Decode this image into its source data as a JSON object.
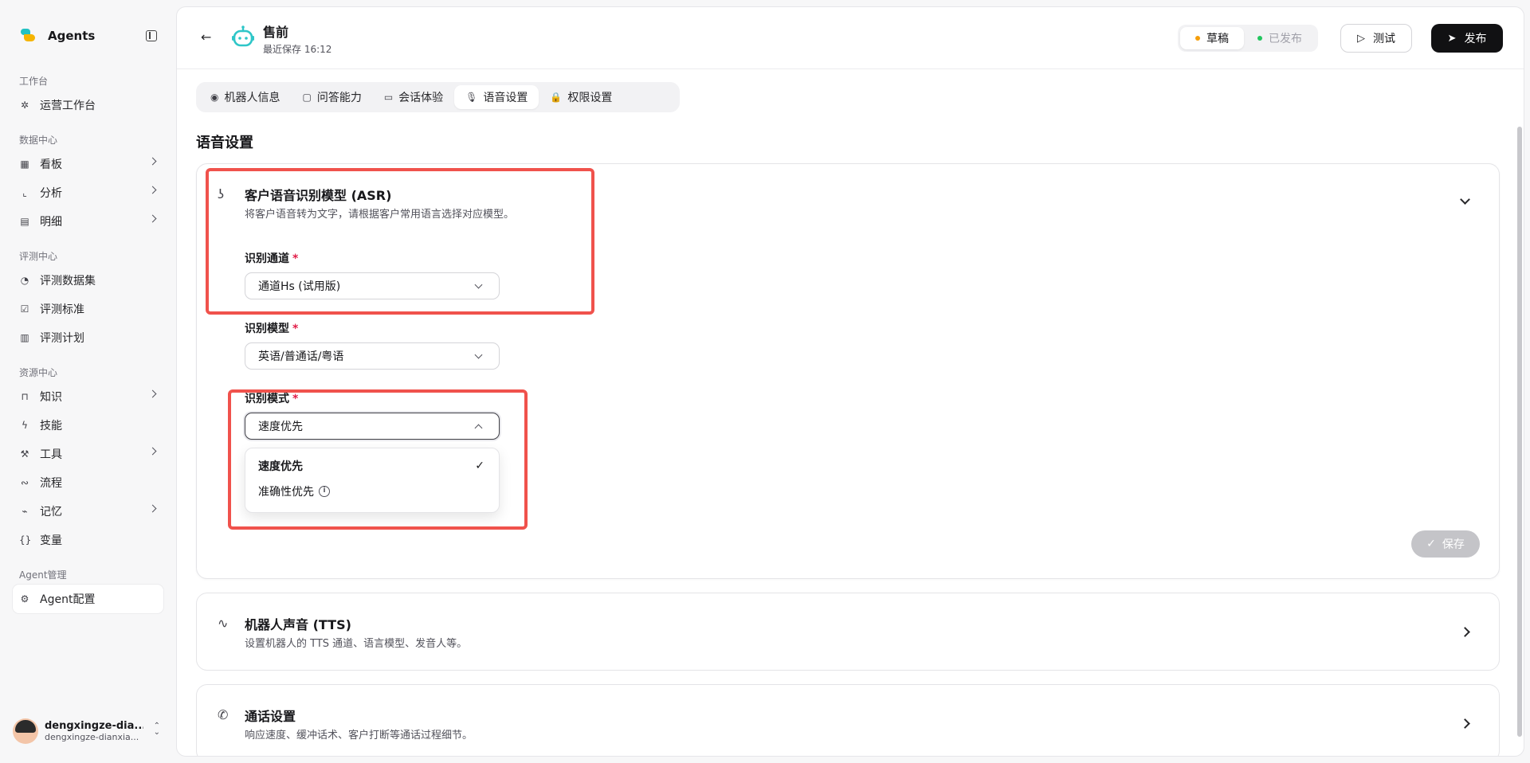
{
  "app": {
    "name": "Agents"
  },
  "sidebar": {
    "groups": [
      {
        "title": "工作台",
        "items": [
          {
            "label": "运营工作台",
            "icon": "sparkle-icon",
            "chevron": false
          }
        ]
      },
      {
        "title": "数据中心",
        "items": [
          {
            "label": "看板",
            "icon": "grid-icon",
            "chevron": true
          },
          {
            "label": "分析",
            "icon": "chart-icon",
            "chevron": true
          },
          {
            "label": "明细",
            "icon": "document-icon",
            "chevron": true
          }
        ]
      },
      {
        "title": "评测中心",
        "items": [
          {
            "label": "评测数据集",
            "icon": "pie-icon",
            "chevron": false
          },
          {
            "label": "评测标准",
            "icon": "check-square-icon",
            "chevron": false
          },
          {
            "label": "评测计划",
            "icon": "clipboard-icon",
            "chevron": false
          }
        ]
      },
      {
        "title": "资源中心",
        "items": [
          {
            "label": "知识",
            "icon": "book-icon",
            "chevron": true
          },
          {
            "label": "技能",
            "icon": "lightning-icon",
            "chevron": false
          },
          {
            "label": "工具",
            "icon": "wrench-icon",
            "chevron": true
          },
          {
            "label": "流程",
            "icon": "flow-icon",
            "chevron": false
          },
          {
            "label": "记忆",
            "icon": "memory-icon",
            "chevron": true
          },
          {
            "label": "变量",
            "icon": "braces-icon",
            "chevron": false
          }
        ]
      },
      {
        "title": "Agent管理",
        "items": [
          {
            "label": "Agent配置",
            "icon": "gear-icon",
            "chevron": false,
            "active": true
          }
        ]
      }
    ],
    "user": {
      "name": "dengxingze-dia...",
      "sub": "dengxingze-dianxia..."
    }
  },
  "header": {
    "title": "售前",
    "saved": "最近保存 16:12",
    "status": {
      "draft": "草稿",
      "published": "已发布",
      "draft_color": "#f59e0b",
      "published_color": "#22c55e"
    },
    "test_label": "测试",
    "publish_label": "发布"
  },
  "tabs": [
    {
      "label": "机器人信息",
      "icon": "user-circle-icon"
    },
    {
      "label": "问答能力",
      "icon": "chat-bubbles-icon"
    },
    {
      "label": "会话体验",
      "icon": "message-icon"
    },
    {
      "label": "语音设置",
      "icon": "microphone-icon",
      "active": true
    },
    {
      "label": "权限设置",
      "icon": "lock-icon"
    }
  ],
  "section_title": "语音设置",
  "asr": {
    "title": "客户语音识别模型 (ASR)",
    "desc": "将客户语音转为文字，请根据客户常用语言选择对应模型。",
    "channel": {
      "label": "识别通道",
      "value": "通道Hs (试用版)"
    },
    "model": {
      "label": "识别模型",
      "value": "英语/普通话/粤语"
    },
    "mode": {
      "label": "识别模式",
      "value": "速度优先",
      "options": [
        "速度优先",
        "准确性优先"
      ]
    },
    "save_label": "保存"
  },
  "tts": {
    "title": "机器人声音 (TTS)",
    "desc": "设置机器人的 TTS 通道、语言模型、发音人等。"
  },
  "call": {
    "title": "通话设置",
    "desc": "响应速度、缓冲话术、客户打断等通话过程细节。"
  },
  "highlight_color": "#f0524c"
}
